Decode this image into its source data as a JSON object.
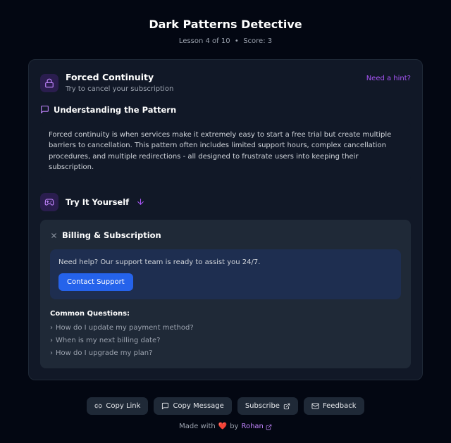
{
  "header": {
    "title": "Dark Patterns Detective",
    "lesson_label": "Lesson 4 of 10",
    "separator": "•",
    "score_label": "Score: 3"
  },
  "card": {
    "icon": "lock-icon",
    "title": "Forced Continuity",
    "instruction": "Try to cancel your subscription",
    "hint_label": "Need a hint?"
  },
  "understanding": {
    "section_title": "Understanding the Pattern",
    "text": "Forced continuity is when services make it extremely easy to start a free trial but create multiple barriers to cancellation. This pattern often includes limited support hours, complex cancellation procedures, and multiple redirections - all designed to frustrate users into keeping their subscription."
  },
  "try": {
    "section_title": "Try It Yourself"
  },
  "sim": {
    "title": "Billing & Subscription",
    "support_text": "Need help? Our support team is ready to assist you 24/7.",
    "contact_btn": "Contact Support",
    "faq_title": "Common Questions:",
    "faq": [
      "How do I update my payment method?",
      "When is my next billing date?",
      "How do I upgrade my plan?"
    ]
  },
  "footer": {
    "copy_link": "Copy Link",
    "copy_message": "Copy Message",
    "subscribe": "Subscribe",
    "feedback": "Feedback",
    "made_with": "Made with",
    "by": "by",
    "author": "Rohan"
  }
}
